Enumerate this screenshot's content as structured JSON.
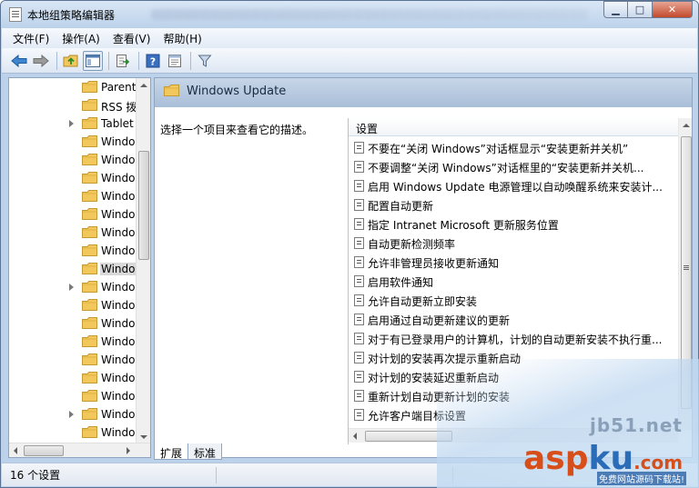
{
  "window": {
    "title": "本地组策略编辑器",
    "buttons": {
      "minimize": "▁",
      "maximize": "□",
      "close": "✕"
    }
  },
  "menu": [
    "文件(F)",
    "操作(A)",
    "查看(V)",
    "帮助(H)"
  ],
  "toolbar": {
    "icons": [
      "back-arrow-icon",
      "forward-arrow-icon",
      "up-folder-icon",
      "show-hide-tree-icon",
      "export-list-icon",
      "help-icon",
      "properties-icon",
      "filter-icon"
    ]
  },
  "tree": {
    "items": [
      {
        "label": "Parent",
        "expandable": false,
        "selected": false
      },
      {
        "label": "RSS 拨",
        "expandable": false,
        "selected": false
      },
      {
        "label": "Tablet",
        "expandable": true,
        "selected": false
      },
      {
        "label": "Windo",
        "expandable": false,
        "selected": false
      },
      {
        "label": "Windo",
        "expandable": false,
        "selected": false
      },
      {
        "label": "Windo",
        "expandable": false,
        "selected": false
      },
      {
        "label": "Windo",
        "expandable": false,
        "selected": false
      },
      {
        "label": "Windo",
        "expandable": false,
        "selected": false
      },
      {
        "label": "Windo",
        "expandable": false,
        "selected": false
      },
      {
        "label": "Windo",
        "expandable": false,
        "selected": false
      },
      {
        "label": "Windo",
        "expandable": false,
        "selected": true
      },
      {
        "label": "Windo",
        "expandable": true,
        "selected": false
      },
      {
        "label": "Windo",
        "expandable": false,
        "selected": false
      },
      {
        "label": "Windo",
        "expandable": false,
        "selected": false
      },
      {
        "label": "Windo",
        "expandable": false,
        "selected": false
      },
      {
        "label": "Windo",
        "expandable": false,
        "selected": false
      },
      {
        "label": "Windo",
        "expandable": false,
        "selected": false
      },
      {
        "label": "Windo",
        "expandable": false,
        "selected": false
      },
      {
        "label": "Windo",
        "expandable": true,
        "selected": false
      },
      {
        "label": "Windo",
        "expandable": false,
        "selected": false
      }
    ]
  },
  "right_pane": {
    "header_title": "Windows Update",
    "description": "选择一个项目来查看它的描述。",
    "column_header": "设置",
    "settings": [
      "不要在“关闭 Windows”对话框显示“安装更新并关机”",
      "不要调整“关闭 Windows”对话框里的“安装更新并关机...",
      "启用 Windows Update 电源管理以自动唤醒系统来安装计...",
      "配置自动更新",
      "指定 Intranet Microsoft 更新服务位置",
      "自动更新检测频率",
      "允许非管理员接收更新通知",
      "启用软件通知",
      "允许自动更新立即安装",
      "启用通过自动更新建议的更新",
      "对于有已登录用户的计算机，计划的自动更新安装不执行重...",
      "对计划的安装再次提示重新启动",
      "对计划的安装延迟重新启动",
      "重新计划自动更新计划的安装",
      "允许客户端目标设置"
    ]
  },
  "tabs": [
    "扩展",
    "标准"
  ],
  "status": {
    "text": "16 个设置"
  },
  "watermark": {
    "site": "jb51.net",
    "brand_part1": "asp",
    "brand_part2": "ku",
    "brand_part3": ".com",
    "sub": "免费网站源码下载站!"
  },
  "colors": {
    "folder": "#f2c75c",
    "header_band": "#b4c8e0",
    "accent_blue": "#2b6cb8"
  }
}
